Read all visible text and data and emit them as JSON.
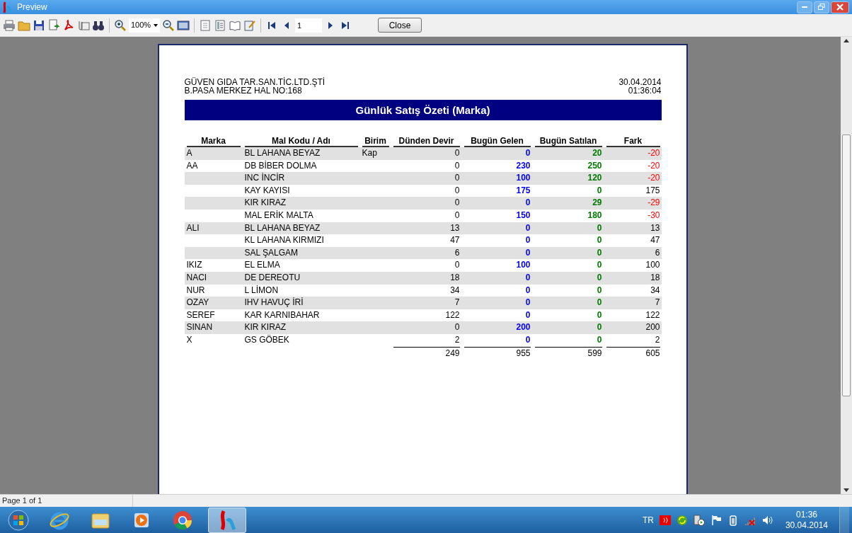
{
  "window": {
    "title": "Preview"
  },
  "toolbar": {
    "zoom": "100%",
    "page": "1",
    "close": "Close"
  },
  "report": {
    "company": "GÜVEN GIDA TAR.SAN.TİC.LTD.ŞTİ",
    "address": "B.PASA MERKEZ HAL NO:168",
    "date": "30.04.2014",
    "time": "01:36:04",
    "title": "Günlük Satış Özeti (Marka)",
    "columns": [
      "Marka",
      "Mal Kodu / Adı",
      "Birim",
      "Dünden Devir",
      "Bugün Gelen",
      "Bugün Satılan",
      "Fark"
    ],
    "rows": [
      {
        "shaded": true,
        "negative": true,
        "cells": [
          "A",
          "BL LAHANA BEYAZ",
          "Kap",
          "0",
          "0",
          "20",
          "-20"
        ]
      },
      {
        "shaded": false,
        "negative": true,
        "cells": [
          "AA",
          "DB BİBER DOLMA",
          "",
          "0",
          "230",
          "250",
          "-20"
        ]
      },
      {
        "shaded": true,
        "negative": true,
        "cells": [
          "",
          "INC İNCİR",
          "",
          "0",
          "100",
          "120",
          "-20"
        ]
      },
      {
        "shaded": false,
        "negative": false,
        "cells": [
          "",
          "KAY KAYISI",
          "",
          "0",
          "175",
          "0",
          "175"
        ]
      },
      {
        "shaded": true,
        "negative": true,
        "cells": [
          "",
          "KIR KIRAZ",
          "",
          "0",
          "0",
          "29",
          "-29"
        ]
      },
      {
        "shaded": false,
        "negative": true,
        "cells": [
          "",
          "MAL ERİK MALTA",
          "",
          "0",
          "150",
          "180",
          "-30"
        ]
      },
      {
        "shaded": true,
        "negative": false,
        "cells": [
          "ALI",
          "BL LAHANA BEYAZ",
          "",
          "13",
          "0",
          "0",
          "13"
        ]
      },
      {
        "shaded": false,
        "negative": false,
        "cells": [
          "",
          "KL LAHANA KIRMIZI",
          "",
          "47",
          "0",
          "0",
          "47"
        ]
      },
      {
        "shaded": true,
        "negative": false,
        "cells": [
          "",
          "SAL ŞALGAM",
          "",
          "6",
          "0",
          "0",
          "6"
        ]
      },
      {
        "shaded": false,
        "negative": false,
        "cells": [
          "IKIZ",
          "EL ELMA",
          "",
          "0",
          "100",
          "0",
          "100"
        ]
      },
      {
        "shaded": true,
        "negative": false,
        "cells": [
          "NACI",
          "DE DEREOTU",
          "",
          "18",
          "0",
          "0",
          "18"
        ]
      },
      {
        "shaded": false,
        "negative": false,
        "cells": [
          "NUR",
          "L LİMON",
          "",
          "34",
          "0",
          "0",
          "34"
        ]
      },
      {
        "shaded": true,
        "negative": false,
        "cells": [
          "OZAY",
          "IHV HAVUÇ İRİ",
          "",
          "7",
          "0",
          "0",
          "7"
        ]
      },
      {
        "shaded": false,
        "negative": false,
        "cells": [
          "SEREF",
          "KAR KARNIBAHAR",
          "",
          "122",
          "0",
          "0",
          "122"
        ]
      },
      {
        "shaded": true,
        "negative": false,
        "cells": [
          "SINAN",
          "KIR KIRAZ",
          "",
          "0",
          "200",
          "0",
          "200"
        ]
      },
      {
        "shaded": false,
        "negative": false,
        "cells": [
          "X",
          "GS GÖBEK",
          "",
          "2",
          "0",
          "0",
          "2"
        ]
      }
    ],
    "totals": [
      "249",
      "955",
      "599",
      "605"
    ]
  },
  "status_bar": {
    "text": "Page 1 of 1"
  },
  "taskbar": {
    "language": "TR",
    "clock_time": "01:36",
    "clock_date": "30.04.2014"
  }
}
